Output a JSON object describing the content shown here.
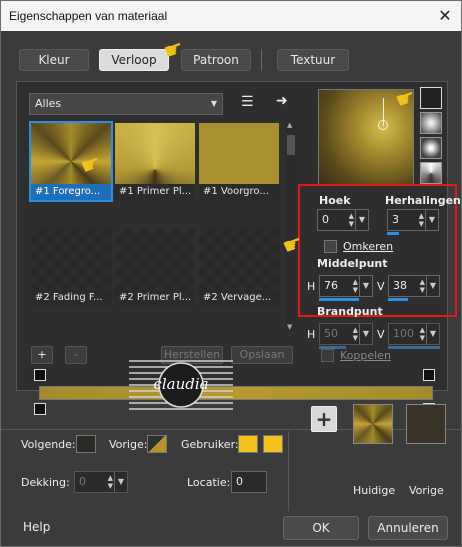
{
  "window": {
    "title": "Eigenschappen van materiaal",
    "close": "✕"
  },
  "tabs": [
    {
      "label": "Kleur"
    },
    {
      "label": "Verloop"
    },
    {
      "label": "Patroon"
    },
    {
      "label": "Textuur"
    }
  ],
  "category_select": {
    "value": "Alles"
  },
  "gradients": [
    {
      "label": "#1 Foregro...",
      "style": "gold"
    },
    {
      "label": "#1 Primer Pl...",
      "style": "gold2"
    },
    {
      "label": "#1 Voorgro...",
      "style": "flat"
    },
    {
      "label": "#2 Fading F...",
      "style": "fade"
    },
    {
      "label": "#2 Primer Pl...",
      "style": "fade"
    },
    {
      "label": "#2 Vervage...",
      "style": "fade"
    }
  ],
  "settings": {
    "hoek_label": "Hoek",
    "hoek_value": "0",
    "herhalingen_label": "Herhalingen",
    "herhalingen_value": "3",
    "omkeren_label": "Omkeren",
    "middelpunt_label": "Middelpunt",
    "h_label": "H",
    "h_value": "76",
    "v_label": "V",
    "v_value": "38",
    "brandpunt_label": "Brandpunt",
    "bh_label": "H",
    "bh_value": "50",
    "bv_label": "V",
    "bv_value": "100",
    "koppelen_label": "Koppelen"
  },
  "editor_buttons": {
    "add": "+",
    "remove": "-",
    "restore": "Herstellen",
    "save": "Opslaan"
  },
  "bottom": {
    "volgende_label": "Volgende:",
    "vorige_label": "Vorige:",
    "gebruiker_label": "Gebruiker:",
    "dekking_label": "Dekking:",
    "dekking_value": "0",
    "locatie_label": "Locatie:",
    "locatie_value": "0",
    "plus": "+",
    "huidige_label": "Huidige",
    "vorige2_label": "Vorige"
  },
  "footer": {
    "help": "Help",
    "ok": "OK",
    "cancel": "Annuleren"
  },
  "watermark": {
    "text": "claudia"
  },
  "colors": {
    "gold": "#a68b2d",
    "dark": "#3a3018",
    "accent": "#2b8fe6",
    "highlight": "#e11919",
    "user_yellow": "#f2c21b"
  }
}
